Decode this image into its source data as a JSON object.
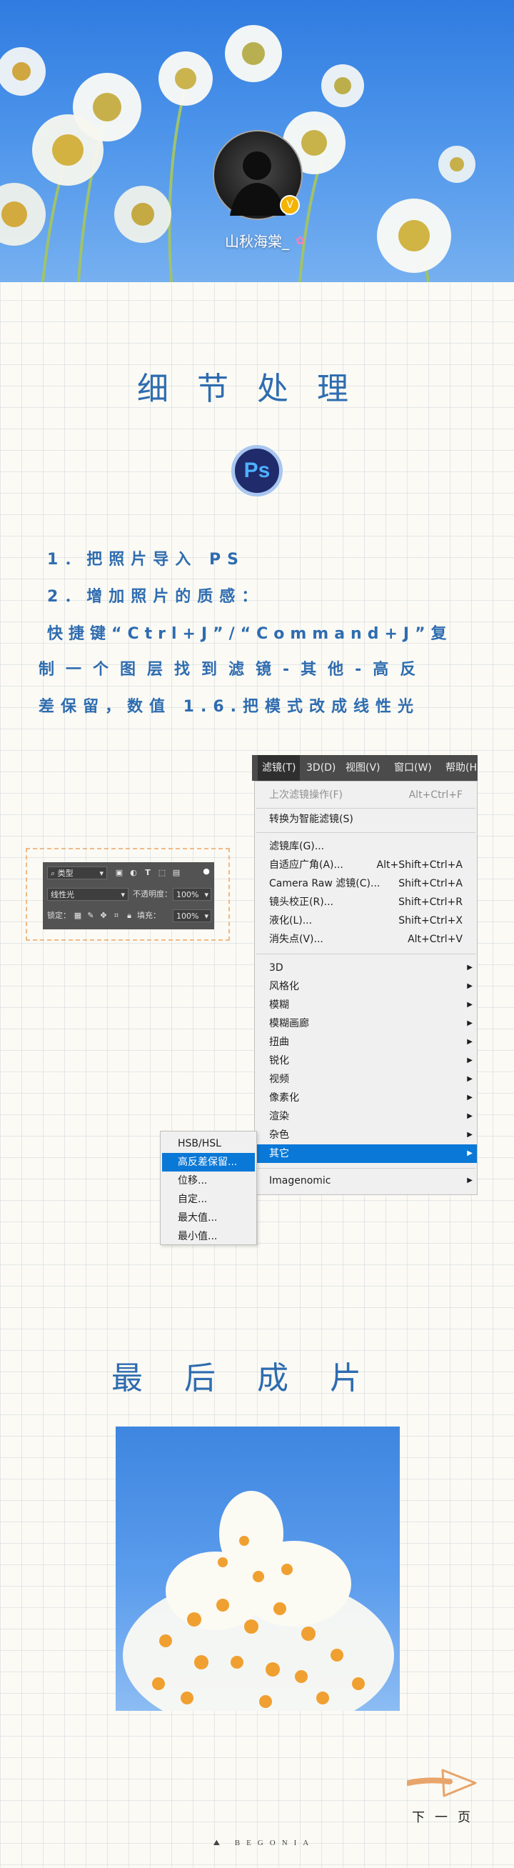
{
  "header": {
    "username": "山秋海棠_",
    "verified_badge": "V",
    "username_icon": "flower-icon"
  },
  "section1": {
    "title": "细节处理",
    "logo_text": "Ps",
    "steps": [
      "1．把照片导入 PS",
      "2．增加照片的质感：",
      "快捷键“Ctrl+J”/“Command+J”复",
      "制一个图层找到滤镜-其他-高反",
      "差保留，数值 1.6.把模式改成线性光"
    ]
  },
  "layers_panel": {
    "kind_filter": "类型",
    "blend_mode": "线性光",
    "opacity_label": "不透明度：",
    "opacity_value": "100%",
    "lock_label": "锁定：",
    "fill_label": "填充：",
    "fill_value": "100%"
  },
  "menubar": {
    "items": [
      "滤镜(T)",
      "3D(D)",
      "视图(V)",
      "窗口(W)",
      "帮助(H"
    ]
  },
  "filter_menu": {
    "items": [
      {
        "label": "上次滤镜操作(F)",
        "shortcut": "Alt+Ctrl+F"
      },
      {
        "label": "转换为智能滤镜(S)"
      },
      {
        "label": "滤镜库(G)..."
      },
      {
        "label": "自适应广角(A)...",
        "shortcut": "Alt+Shift+Ctrl+A"
      },
      {
        "label": "Camera Raw 滤镜(C)...",
        "shortcut": "Shift+Ctrl+A"
      },
      {
        "label": "镜头校正(R)...",
        "shortcut": "Shift+Ctrl+R"
      },
      {
        "label": "液化(L)...",
        "shortcut": "Shift+Ctrl+X"
      },
      {
        "label": "消失点(V)...",
        "shortcut": "Alt+Ctrl+V"
      },
      {
        "label": "3D"
      },
      {
        "label": "风格化"
      },
      {
        "label": "模糊"
      },
      {
        "label": "模糊画廊"
      },
      {
        "label": "扭曲"
      },
      {
        "label": "锐化"
      },
      {
        "label": "视频"
      },
      {
        "label": "像素化"
      },
      {
        "label": "渲染"
      },
      {
        "label": "杂色"
      },
      {
        "label": "其它"
      },
      {
        "label": "Imagenomic"
      }
    ]
  },
  "submenu": {
    "items": [
      "HSB/HSL",
      "高反差保留...",
      "位移...",
      "自定...",
      "最大值...",
      "最小值..."
    ]
  },
  "section2": {
    "title": "最后成片"
  },
  "footer": {
    "next_page": "下一页",
    "brand": "BEGONIA"
  },
  "colors": {
    "accent": "#2e6cb0",
    "menu_highlight": "#0a78d7",
    "dashed_border": "#f0b987",
    "arrow": "#e8a46a"
  }
}
